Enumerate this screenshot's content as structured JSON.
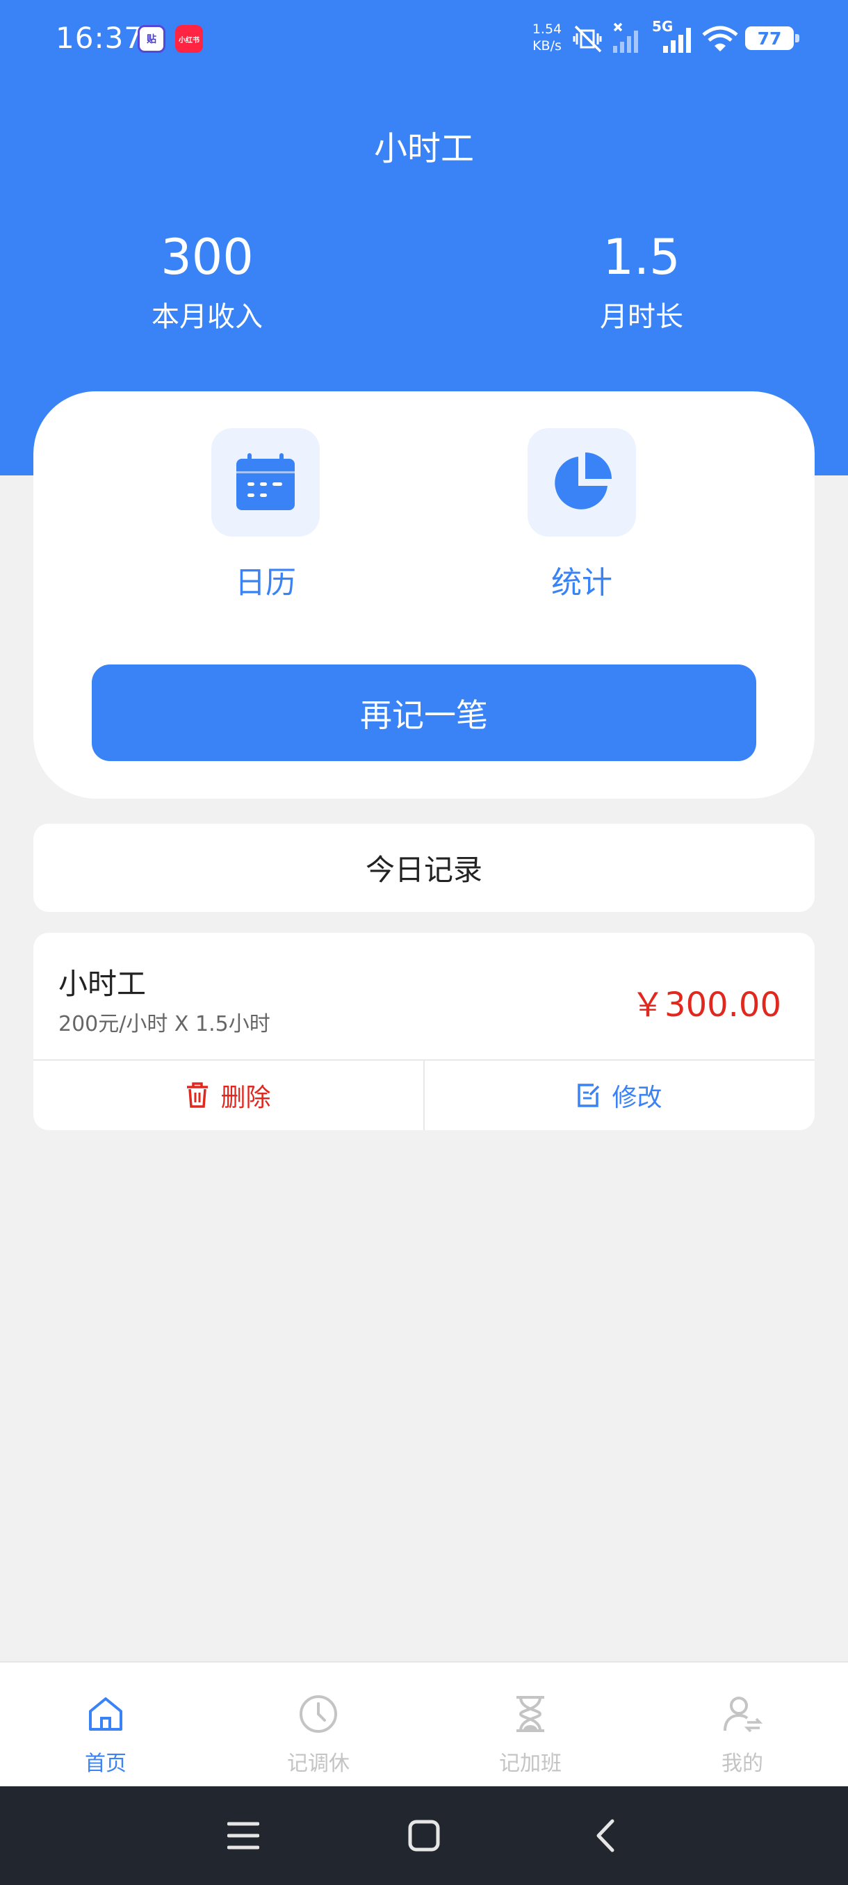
{
  "status_bar": {
    "time": "16:37",
    "app1_label": "贴",
    "app2_label": "小红书",
    "net_speed_value": "1.54",
    "net_speed_unit": "KB/s",
    "network_type": "5G",
    "battery": "77"
  },
  "header": {
    "title": "小时工",
    "stats": [
      {
        "value": "300",
        "label": "本月收入"
      },
      {
        "value": "1.5",
        "label": "月时长"
      }
    ]
  },
  "actions": {
    "calendar_label": "日历",
    "statistics_label": "统计",
    "record_again_label": "再记一笔"
  },
  "today": {
    "title": "今日记录"
  },
  "records": [
    {
      "title": "小时工",
      "detail": "200元/小时 X 1.5小时",
      "amount": "￥300.00",
      "delete_label": "删除",
      "edit_label": "修改"
    }
  ],
  "tabbar": {
    "items": [
      {
        "label": "首页",
        "icon": "home-icon",
        "active": true
      },
      {
        "label": "记调休",
        "icon": "clock-icon",
        "active": false
      },
      {
        "label": "记加班",
        "icon": "hourglass-icon",
        "active": false
      },
      {
        "label": "我的",
        "icon": "user-icon",
        "active": false
      }
    ]
  },
  "colors": {
    "primary": "#3a83f7",
    "danger": "#e0281e",
    "background": "#f1f1f1",
    "nav_bar": "#22262f"
  }
}
